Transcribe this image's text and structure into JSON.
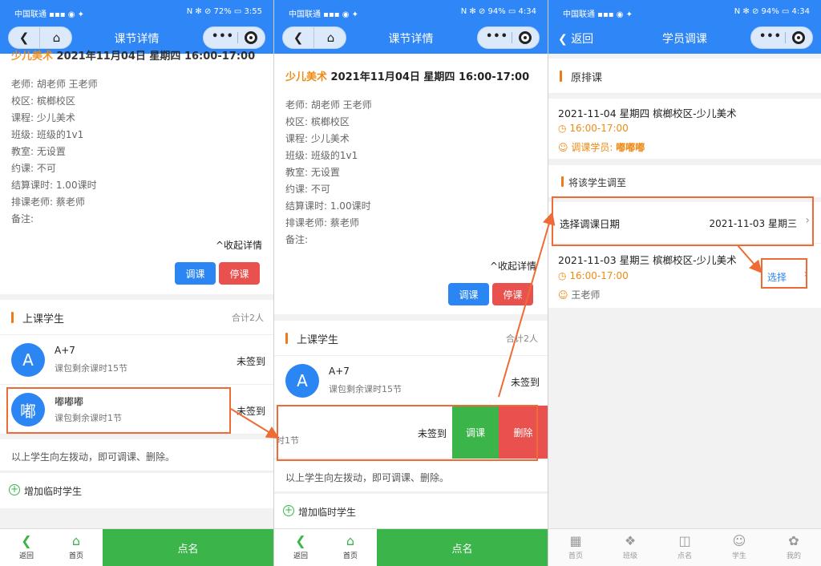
{
  "status1": {
    "left": "中国联通 ▪▪▪ ◉ ✦",
    "right": "N ✻ ⊘ 72% ▭ 3:55"
  },
  "status2": {
    "left": "中国联通 ▪▪▪ ◉ ✦",
    "right": "N ✻ ⊘ 94% ▭ 4:34"
  },
  "status3": {
    "left": "中国联通 ▪▪▪ ◉ ✦",
    "right": "N ✻ ⊘ 94% ▭ 4:34"
  },
  "panel1": {
    "title": "课节详情",
    "course_header_orange": "少儿美术",
    "course_header_rest": " 2021年11月04日 星期四 16:00-17:00",
    "details": [
      "老师:  胡老师 王老师",
      "校区:  槟榔校区",
      "课程:  少儿美术",
      "班级:  班级的1v1",
      "教室:  无设置",
      "约课:  不可",
      "结算课时:  1.00课时",
      "排课老师:  蔡老师",
      "备注:"
    ],
    "collapse": "^收起详情",
    "btn_reschedule": "调课",
    "btn_stop": "停课",
    "section_title": "上课学生",
    "section_count": "合计2人",
    "students": [
      {
        "avatar": "A",
        "name": "A+7",
        "sub": "课包剩余课时15节",
        "status": "未签到"
      },
      {
        "avatar": "嘟",
        "name": "嘟嘟嘟",
        "sub": "课包剩余课时1节",
        "status": "未签到"
      }
    ],
    "tip": "以上学生向左拨动，即可调课、删除。",
    "add_student": "增加临时学生",
    "bottom": {
      "back": "返回",
      "home": "首页",
      "rollcall": "点名"
    }
  },
  "panel2": {
    "title": "课节详情",
    "course_header_orange": "少儿美术",
    "course_header_rest": " 2021年11月04日 星期四 16:00-17:00",
    "details": [
      "老师:  胡老师 王老师",
      "校区:  槟榔校区",
      "课程:  少儿美术",
      "班级:  班级的1v1",
      "教室:  无设置",
      "约课:  不可",
      "结算课时:  1.00课时",
      "排课老师:  蔡老师",
      "备注:"
    ],
    "collapse": "^收起详情",
    "btn_reschedule": "调课",
    "btn_stop": "停课",
    "section_title": "上课学生",
    "section_count": "合计2人",
    "student1": {
      "avatar": "A",
      "name": "A+7",
      "sub": "课包剩余课时15节",
      "status": "未签到"
    },
    "swiped": {
      "sub_fragment": "时1节",
      "status": "未签到",
      "action_reschedule": "调课",
      "action_delete": "删除"
    },
    "tip": "以上学生向左拨动，即可调课、删除。",
    "add_student": "增加临时学生",
    "bottom": {
      "back": "返回",
      "home": "首页",
      "rollcall": "点名"
    }
  },
  "panel3": {
    "back": "返回",
    "title": "学员调课",
    "orig_section": "原排课",
    "orig_line1": "2021-11-04 星期四 槟榔校区-少儿美术",
    "orig_time": "16:00-17:00",
    "orig_student_label": "调课学员:",
    "orig_student_name": "嘟嘟嘟",
    "move_section": "将该学生调至",
    "pick_date_label": "选择调课日期",
    "pick_date_value": "2021-11-03 星期三",
    "opt_line1": "2021-11-03 星期三 槟榔校区-少儿美术",
    "opt_time": "16:00-17:00",
    "opt_teacher": "王老师",
    "opt_select": "选择",
    "tabs": [
      "首页",
      "班级",
      "点名",
      "学生",
      "我的"
    ]
  },
  "colors": {
    "primary": "#2f86f6",
    "orange": "#ef8a14",
    "green": "#3bb54a",
    "red": "#e8514d",
    "highlight": "#ee6b35"
  }
}
